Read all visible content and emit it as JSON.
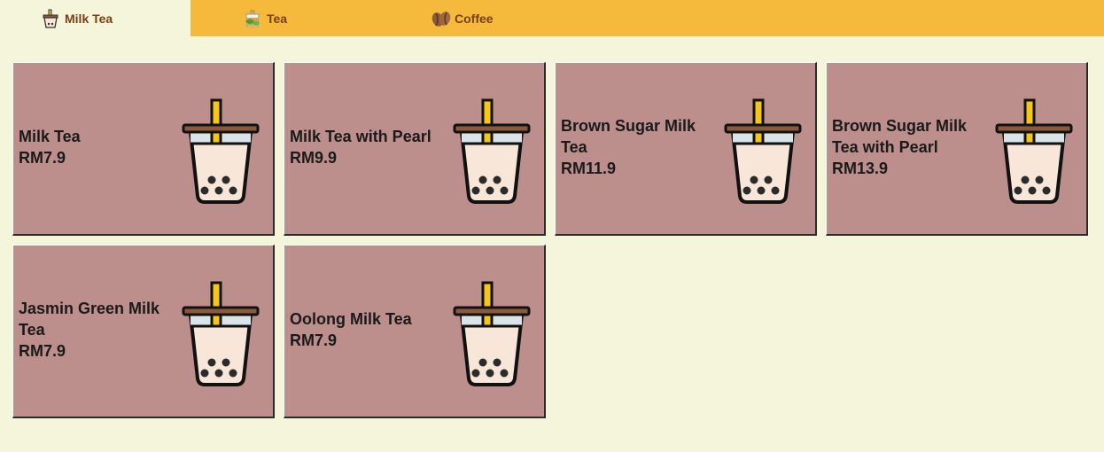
{
  "tabs": [
    {
      "label": "Milk Tea",
      "icon": "milk-tea-icon",
      "active": true
    },
    {
      "label": "Tea",
      "icon": "tea-icon",
      "active": false
    },
    {
      "label": "Coffee",
      "icon": "coffee-beans-icon",
      "active": false
    }
  ],
  "products": [
    {
      "name": "Milk Tea",
      "price": "RM7.9",
      "icon": "bubble-tea-icon"
    },
    {
      "name": "Milk Tea with Pearl",
      "price": "RM9.9",
      "icon": "bubble-tea-icon"
    },
    {
      "name": "Brown Sugar Milk Tea",
      "price": "RM11.9",
      "icon": "bubble-tea-icon"
    },
    {
      "name": "Brown Sugar Milk Tea with Pearl",
      "price": "RM13.9",
      "icon": "bubble-tea-icon"
    },
    {
      "name": "Jasmin Green Milk Tea",
      "price": "RM7.9",
      "icon": "bubble-tea-icon"
    },
    {
      "name": "Oolong Milk Tea",
      "price": "RM7.9",
      "icon": "bubble-tea-icon"
    }
  ],
  "colors": {
    "tab_bar": "#f5b93b",
    "background": "#f5f5dc",
    "card": "#bc8e8c",
    "tab_text": "#7a3e12"
  }
}
